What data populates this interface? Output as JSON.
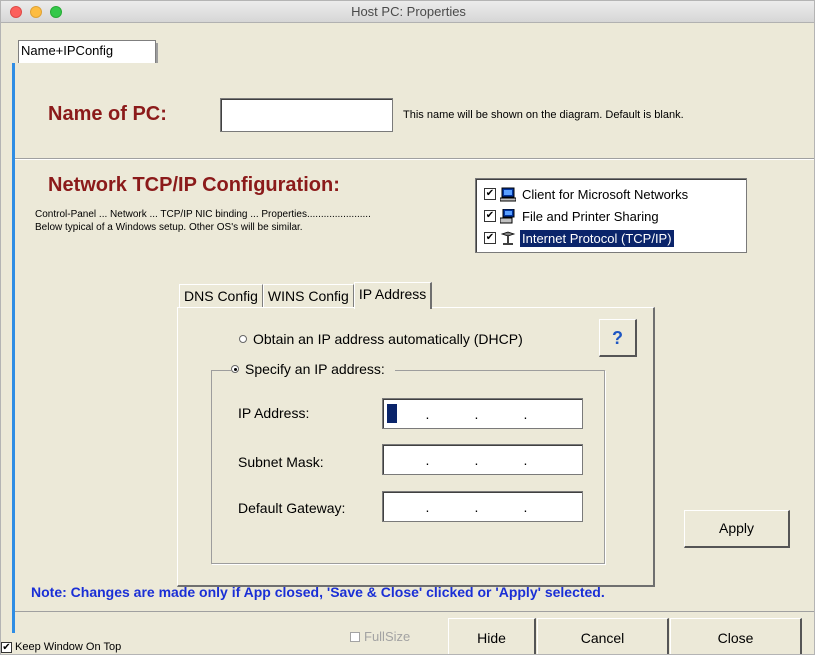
{
  "window": {
    "title": "Host PC: Properties",
    "colors": {
      "accent": "#2f8de4",
      "heading": "#8b1a1a",
      "note": "#1a2fd6",
      "selection": "#0a246a"
    }
  },
  "main_tab": {
    "label": "Name+IPConfig"
  },
  "name_section": {
    "label": "Name of PC:",
    "value": "",
    "hint": "This name will be shown on the diagram.  Default is blank."
  },
  "network_section": {
    "title": "Network TCP/IP Configuration:",
    "desc_line1": "Control-Panel ... Network ... TCP/IP NIC binding ... Properties.......................",
    "desc_line2": "Below typical of a Windows setup.  Other OS's will be similar.",
    "bindings": [
      {
        "label": "Client for Microsoft Networks",
        "checked": true,
        "icon": "network-computer-icon",
        "selected": false
      },
      {
        "label": "File and Printer Sharing",
        "checked": true,
        "icon": "printer-sharing-icon",
        "selected": false
      },
      {
        "label": "Internet Protocol (TCP/IP)",
        "checked": true,
        "icon": "protocol-icon",
        "selected": true
      }
    ]
  },
  "tabs": {
    "dns": "DNS Config",
    "wins": "WINS Config",
    "ip": "IP Address",
    "active": "ip"
  },
  "ip_panel": {
    "dhcp_label": "Obtain an IP address automatically (DHCP)",
    "specify_label": "Specify an IP address:",
    "mode": "specify",
    "help_label": "?",
    "fields": {
      "ip_label": "IP Address:",
      "subnet_label": "Subnet Mask:",
      "gateway_label": "Default Gateway:",
      "dot": "."
    },
    "apply_label": "Apply"
  },
  "note": "Note: Changes are made only if App closed, 'Save & Close' clicked or 'Apply' selected.",
  "footer": {
    "keep_on_top": "Keep Window On Top",
    "keep_checked": true,
    "fullsize": "FullSize",
    "hide": "Hide",
    "cancel": "Cancel",
    "close": "Close"
  }
}
